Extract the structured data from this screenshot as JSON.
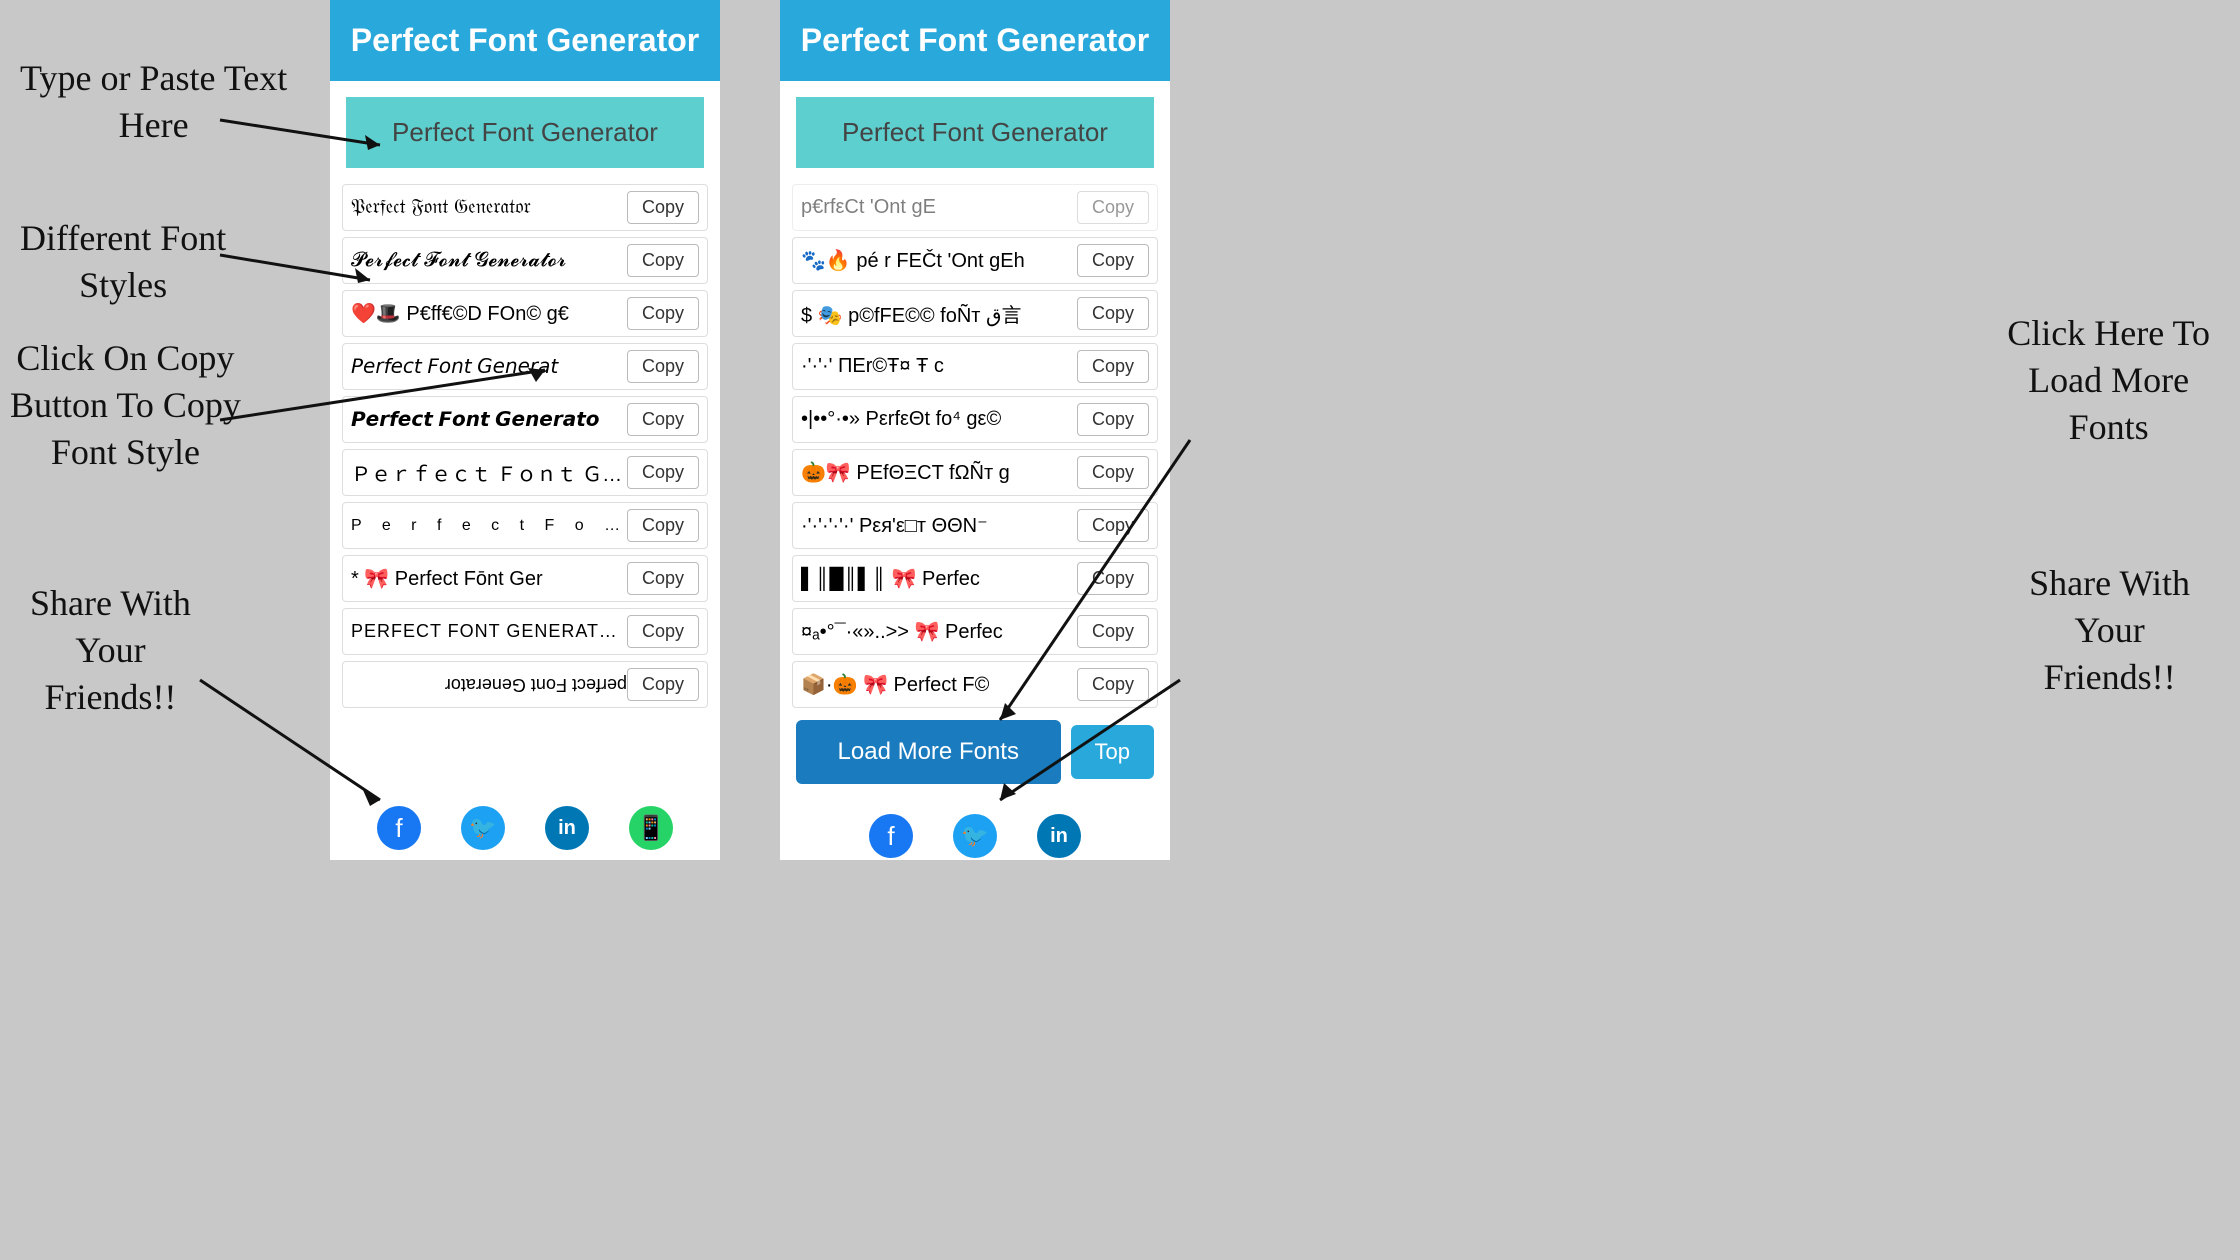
{
  "app": {
    "title": "Perfect Font Generator"
  },
  "annotations": {
    "type_here": "Type or Paste Text\nHere",
    "diff_fonts": "Different Font\nStyles",
    "click_copy": "Click On Copy\nButton To Copy\nFont Style",
    "share": "Share With\nYour\nFriends!!",
    "load_more": "Click Here To\nLoad More\nFonts",
    "share_right": "Share With\nYour\nFriends!!"
  },
  "panel1": {
    "header": "Perfect Font Generator",
    "input_placeholder": "Perfect Font Generator",
    "fonts": [
      {
        "text": "𝔓𝔢𝔯𝔣𝔢𝔠𝔱 𝔉𝔬𝔫𝔱 𝔊𝔢𝔫𝔢𝔯𝔞𝔱𝔬𝔯",
        "copy": "Copy"
      },
      {
        "text": "𝓟𝓮𝓻𝓯𝓮𝓬𝓽 𝓕𝓸𝓷𝓽 𝓖𝓮𝓷𝓮𝓻𝓪𝓽𝓸𝓻",
        "copy": "Copy"
      },
      {
        "text": "❤️🎩 P€ff€©D FOn© g€",
        "copy": "Copy"
      },
      {
        "text": "𝘗𝘦𝘳𝘧𝘦𝘤𝘵 𝘍𝘰𝘯𝘵 𝘎𝘦𝘯𝘦𝘳𝘢𝘵",
        "copy": "Copy"
      },
      {
        "text": "𝙋𝙚𝙧𝙛𝙚𝙘𝙩 𝙁𝙤𝙣𝙩 𝙂𝙚𝙣𝙚𝙧𝙖𝙩𝙤",
        "copy": "Copy"
      },
      {
        "text": "Ｐｅｒｆｅｃｔ Ｆｏｎｔ Ｇｅｎｅｒａｔｏｒ",
        "copy": "Copy"
      },
      {
        "text": "P e r f e c t  F o n t",
        "copy": "Copy"
      },
      {
        "text": "* 🎀 Perfect Fōnt Ger",
        "copy": "Copy"
      },
      {
        "text": "PERFECT FONT GENERATOR",
        "copy": "Copy"
      },
      {
        "text": "ɹoʇɐɹǝuǝƃ ʇuoℲ ʇɔǝɟɹǝd",
        "copy": "Copy"
      }
    ],
    "social": [
      "fb",
      "tw",
      "li",
      "wa"
    ]
  },
  "panel2": {
    "header": "Perfect Font Generator",
    "input_placeholder": "Perfect Font Generator",
    "fonts": [
      {
        "text": "🐾🔥 p€rf€©t 'Ont gEh",
        "copy": "Copy"
      },
      {
        "text": "$ 🎭 p©fFE©© foÑт ق言",
        "copy": "Copy"
      },
      {
        "text": "·'·'·'·' ΠΕr©Ŧ¤ Ŧ c",
        "copy": "Copy"
      },
      {
        "text": "•|••°·•» PεrfεΘt fo⁴ gε©",
        "copy": "Copy"
      },
      {
        "text": "🎃🎀 ΡΕfΘΞCΤ fΩÑт g",
        "copy": "Copy"
      },
      {
        "text": "·'·'·'·'·' Ρεя'ε□т ΘΘΝ⁻",
        "copy": "Copy"
      },
      {
        "text": "▌║█║▌║ 🎀 Perfec",
        "copy": "Copy"
      },
      {
        "text": "¤ₐ•°¯·«»..>> 🎀 Perfec",
        "copy": "Copy"
      },
      {
        "text": "📦·🎃 🎀 Perfect F©",
        "copy": "Copy"
      }
    ],
    "load_more": "Load More Fonts",
    "top": "Top",
    "social": [
      "fb",
      "tw",
      "li"
    ]
  },
  "colors": {
    "header_bg": "#29a8dc",
    "input_bg": "#5dcfcf",
    "load_more_bg": "#1a7bbf",
    "top_bg": "#29a8dc",
    "fb": "#1877f2",
    "tw": "#1da1f2",
    "li": "#0077b5",
    "wa": "#25d366"
  }
}
